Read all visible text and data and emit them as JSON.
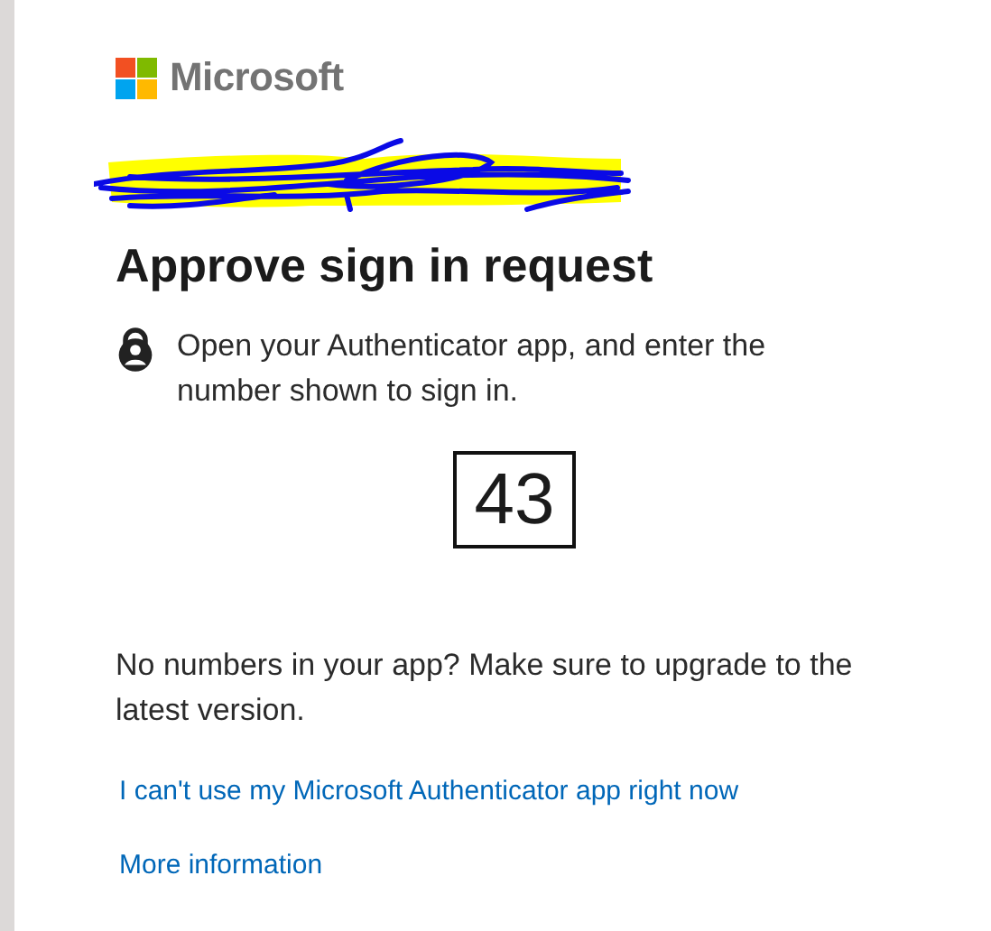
{
  "brand": {
    "name": "Microsoft"
  },
  "title": "Approve sign in request",
  "instruction": "Open your Authenticator app, and enter the number shown to sign in.",
  "code": "43",
  "note": "No numbers in your app? Make sure to upgrade to the latest version.",
  "links": [
    "I can't use my Microsoft Authenticator app right now",
    "More information"
  ]
}
